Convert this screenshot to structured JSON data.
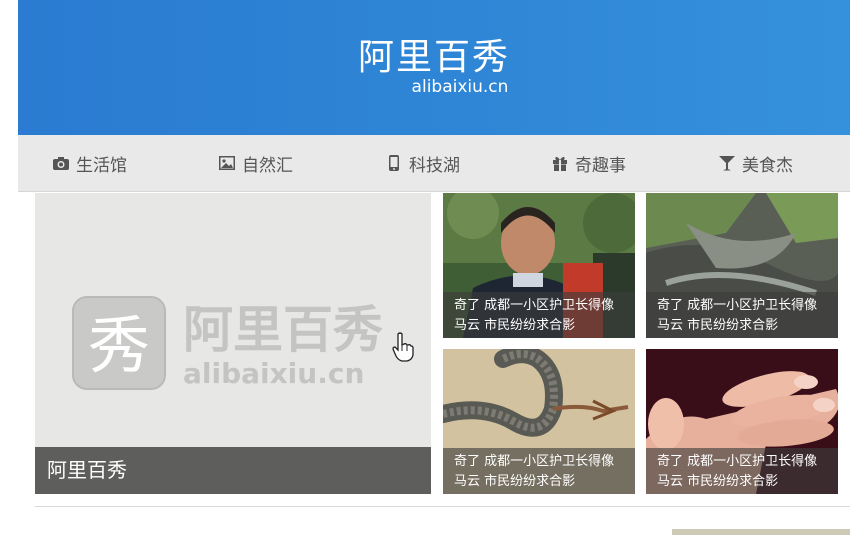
{
  "site": {
    "title": "阿里百秀",
    "domain": "alibaixiu.cn"
  },
  "nav": {
    "items": [
      {
        "label": "生活馆",
        "icon": "camera-icon"
      },
      {
        "label": "自然汇",
        "icon": "image-icon"
      },
      {
        "label": "科技湖",
        "icon": "mobile-phone-icon"
      },
      {
        "label": "奇趣事",
        "icon": "gift-icon"
      },
      {
        "label": "美食杰",
        "icon": "cocktail-glass-icon"
      }
    ]
  },
  "feature": {
    "caption": "阿里百秀",
    "watermark_title": "阿里百秀",
    "watermark_domain": "alibaixiu.cn",
    "watermark_glyph": "秀"
  },
  "thumbs": [
    {
      "line1": "奇了 成都一小区护卫长得像",
      "line2": "马云 市民纷纷求合影",
      "image": "man-portrait"
    },
    {
      "line1": "奇了 成都一小区护卫长得像",
      "line2": "马云 市民纷纷求合影",
      "image": "rock-landscape"
    },
    {
      "line1": "奇了 成都一小区护卫长得像",
      "line2": "马云 市民纷纷求合影",
      "image": "snake"
    },
    {
      "line1": "奇了 成都一小区护卫长得像",
      "line2": "马云 市民纷纷求合影",
      "image": "hand"
    }
  ],
  "colors": {
    "header": "#2f86d6",
    "nav_bg": "#e9e9e9",
    "caption_bg": "#5e5f5c"
  }
}
